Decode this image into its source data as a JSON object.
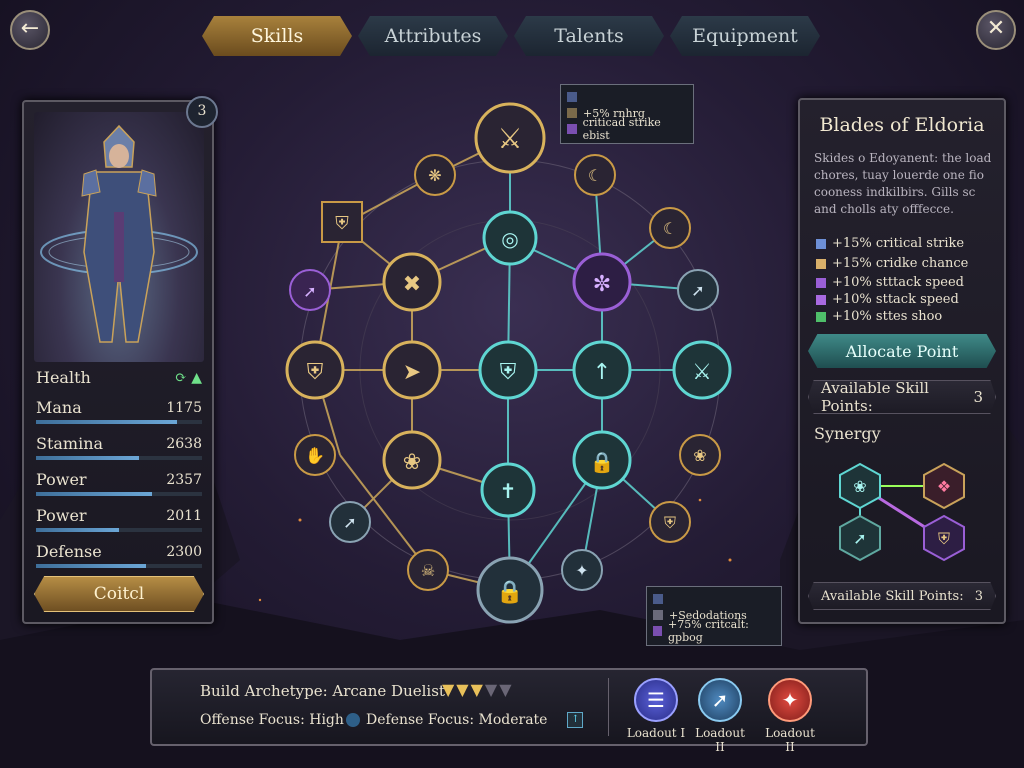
{
  "window": {
    "back_icon": "arrow-left-icon",
    "close_icon": "close-icon"
  },
  "tabs": [
    {
      "label": "Skills",
      "active": true
    },
    {
      "label": "Attributes",
      "active": false
    },
    {
      "label": "Talents",
      "active": false
    },
    {
      "label": "Equipment",
      "active": false
    }
  ],
  "character": {
    "level_badge": "3",
    "stats": [
      {
        "label": "Health",
        "value": "",
        "fill": 0.0
      },
      {
        "label": "Mana",
        "value": "1175",
        "fill": 0.85
      },
      {
        "label": "Stamina",
        "value": "2638",
        "fill": 0.62
      },
      {
        "label": "Power",
        "value": "2357",
        "fill": 0.7
      },
      {
        "label": "Power",
        "value": "2011",
        "fill": 0.5
      },
      {
        "label": "Defense",
        "value": "2300",
        "fill": 0.66
      }
    ],
    "confirm_label": "Coitcl"
  },
  "tooltip_top": {
    "lines": [
      "+5% rnhrg",
      "criticad strike ebist"
    ]
  },
  "tooltip_bottom": {
    "lines": [
      "+Sedodations",
      "+75% critcalt: gpbog"
    ]
  },
  "skill_info": {
    "title": "Blades of Eldoria",
    "description": "Skides o Edoyanent: the load chores, tuay louerde one fio cooness indkilbirs. Gills sc and cholls aty offfecce.",
    "bonuses": [
      {
        "text": "+15% critical strike",
        "color": "#6d8fd6"
      },
      {
        "text": "+15% cridke chance",
        "color": "#d9b06a"
      },
      {
        "text": "+10% stttack speed",
        "color": "#9a5fd6"
      },
      {
        "text": "+10% sttack speed",
        "color": "#a86ae0"
      },
      {
        "text": "+10% sttes shoo",
        "color": "#4fbf6a"
      }
    ],
    "allocate_label": "Allocate Point",
    "points_label": "Available Skill Points:",
    "points_value": "3",
    "synergy_label": "Synergy",
    "points_label_2": "Available Skill Points:",
    "points_value_2": "3"
  },
  "build": {
    "archetype": "Build Archetype: Arcane Duelist",
    "offense": "Offense Focus: High",
    "defense": "Defense Focus: Moderate",
    "stars_filled": 3,
    "stars_total": 5
  },
  "loadouts": [
    {
      "label": "Loadout I",
      "color": "#3a3fa8",
      "icon": "rune-icon"
    },
    {
      "label": "Loadout II",
      "color": "#2e5f88",
      "icon": "sword-icon"
    },
    {
      "label": "Loadout II",
      "color": "#a8302c",
      "icon": "flame-icon"
    }
  ],
  "colors": {
    "gold": "#d8b25c",
    "teal": "#5fd6d2",
    "purple": "#9a5fd6"
  }
}
